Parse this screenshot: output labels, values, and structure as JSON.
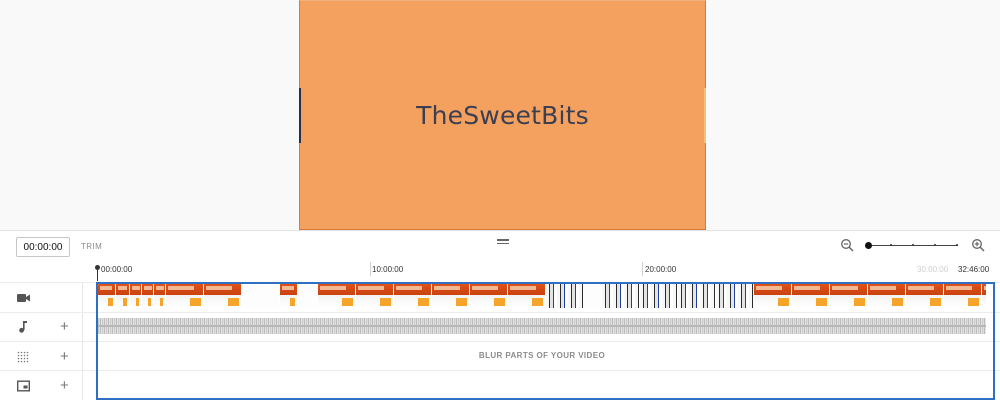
{
  "preview": {
    "title_text": "TheSweetBits",
    "colors": {
      "frame": "#f4a15f",
      "text": "#3b3f52"
    }
  },
  "editor": {
    "timecode": "00:00:00",
    "trim_label": "TRIM",
    "icons": {
      "drag_handle": "drag-handle-icon",
      "zoom_out": "zoom-out-icon",
      "zoom_in": "zoom-in-icon"
    }
  },
  "ruler": {
    "labels": [
      "00:00:00",
      "10:00:00",
      "20:00:00",
      "30:00:00",
      "32:46:00"
    ]
  },
  "tracks": {
    "video": {
      "icon": "video-camera-icon"
    },
    "audio": {
      "icon": "music-note-icon",
      "add": "+"
    },
    "blur": {
      "icon": "blur-grid-icon",
      "add": "+",
      "label": "BLUR PARTS OF YOUR VIDEO"
    },
    "endscreen": {
      "icon": "end-screen-icon",
      "add": "+"
    }
  },
  "accent_color": "#2e6fc2"
}
